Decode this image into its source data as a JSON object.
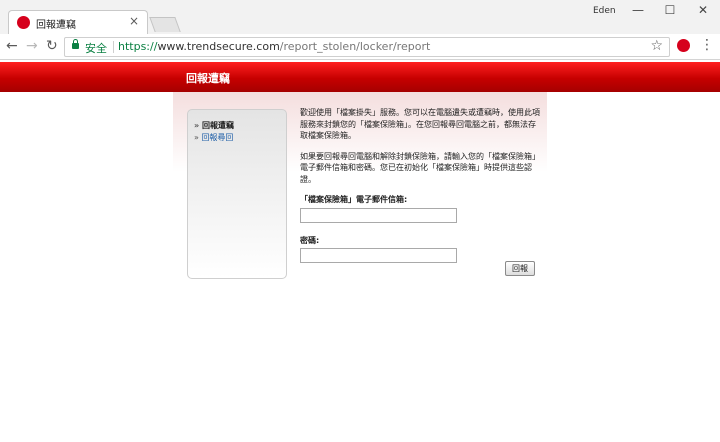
{
  "browser": {
    "tab_title": "回報遭竊",
    "tab_close": "×",
    "profile_name": "Eden",
    "window_controls": {
      "minimize": "—",
      "maximize": "☐",
      "close": "✕"
    },
    "secure_label": "安全",
    "url_scheme": "https://",
    "url_host": "www.trendsecure.com",
    "url_path": "/report_stolen/locker/report",
    "icons": [
      "back-arrow-icon",
      "forward-arrow-icon",
      "reload-icon",
      "lock-icon",
      "star-icon",
      "extension-icon",
      "menu-icon"
    ]
  },
  "colors": {
    "banner": "#c60000",
    "secure": "#0b8043",
    "link": "#1f5fa8"
  },
  "banner": {
    "title": "回報遭竊"
  },
  "sidebar": {
    "items": [
      {
        "label": "回報遭竊"
      },
      {
        "label": "回報尋回"
      }
    ]
  },
  "main": {
    "para1": "歡迎使用「檔案掛失」服務。您可以在電腦遺失或遭竊時，使用此項服務來封鎖您的「檔案保險箱」。在您回報尋回電腦之前，都無法存取檔案保險箱。",
    "para2": "如果要回報尋回電腦和解除封鎖保險箱，請輸入您的「檔案保險箱」電子郵件信箱和密碼。您已在初始化「檔案保險箱」時提供這些認證。",
    "email_label": "「檔案保險箱」電子郵件信箱:",
    "email_value": "",
    "password_label": "密碼:",
    "password_value": "",
    "submit_label": "回報"
  }
}
